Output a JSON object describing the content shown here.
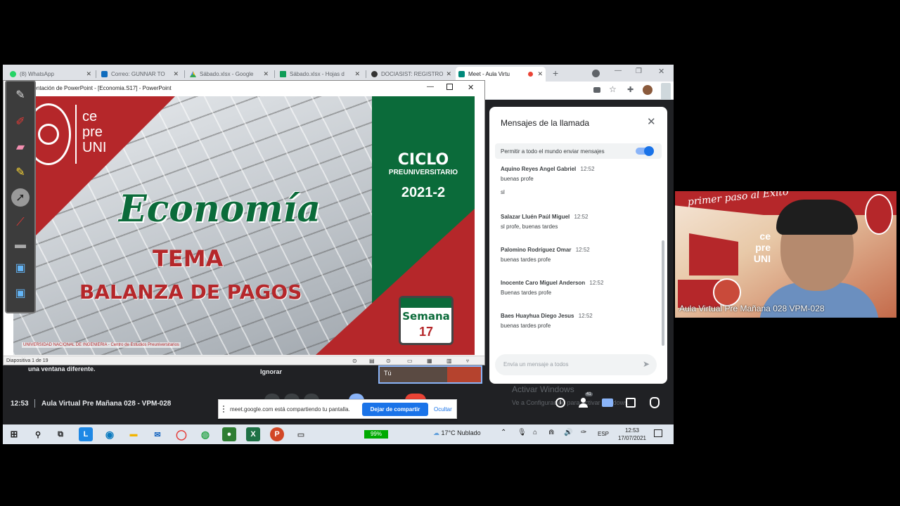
{
  "browser": {
    "tabs": [
      {
        "label": "(8) WhatsApp",
        "color": "#25d366"
      },
      {
        "label": "Correo: GUNNAR TO",
        "color": "#0f6cbd"
      },
      {
        "label": "Sábado.xlsx - Google",
        "color": "#188038"
      },
      {
        "label": "Sábado.xlsx - Hojas d",
        "color": "#0f9d58"
      },
      {
        "label": "DOCIASIST: REGISTRO",
        "color": "#333333"
      },
      {
        "label": "Meet - Aula Virtu",
        "color": "#00897b"
      }
    ],
    "new_tab": "+"
  },
  "powerpoint": {
    "title": "Presentación de PowerPoint - [Economia.S17] - PowerPoint",
    "status": "Diapositiva 1 de 19"
  },
  "slide": {
    "logo_text": [
      "ce",
      "pre",
      "UNI"
    ],
    "ciclo": "CICLO",
    "preuniversitario": "PREUNIVERSITARIO",
    "year": "2021-2",
    "subject": "Economía",
    "tema": "TEMA",
    "topic": "BALANZA DE PAGOS",
    "semana_label": "Semana",
    "semana_num": "17",
    "footer": "UNIVERSIDAD NACIONAL DE INGENIERIA - Centro de Estudios Preuniversitarios"
  },
  "chat": {
    "title": "Mensajes de la llamada",
    "allow_label": "Permitir a todo el mundo enviar mensajes",
    "messages": [
      {
        "name": "Aquino Reyes Angel Gabriel",
        "time": "12:52",
        "texts": [
          "buenas profe",
          "sl"
        ]
      },
      {
        "name": "Salazar Lluén Paúl Miguel",
        "time": "12:52",
        "texts": [
          "sl profe, buenas tardes"
        ]
      },
      {
        "name": "Palomino Rodríguez Omar",
        "time": "12:52",
        "texts": [
          "buenas tardes profe"
        ]
      },
      {
        "name": "Inocente Caro Miguel Anderson",
        "time": "12:52",
        "texts": [
          "Buenas tardes profe"
        ]
      },
      {
        "name": "Baes Huayhua Diego Jesus",
        "time": "12:52",
        "texts": [
          "buenas tardes profe"
        ]
      }
    ],
    "input_placeholder": "Envía un mensaje a todos"
  },
  "meet": {
    "time": "12:53",
    "meeting_name": "Aula Virtual Pre Mañana 028 - VPM-028",
    "notice_text": "una ventana diferente.",
    "ignore": "Ignorar",
    "self_label": "Tú",
    "share_text": "meet.google.com está compartiendo tu pantalla.",
    "stop_share": "Dejar de compartir",
    "hide": "Ocultar",
    "people_count": "41",
    "activate_title": "Activar Windows",
    "activate_sub": "Ve a Configuración para activar Windows."
  },
  "camera": {
    "label": "Aula Virtual Pre Mañana 028 VPM-028",
    "banner": "primer paso al Éxito",
    "logo_text": [
      "ce",
      "pre",
      "UNI"
    ]
  },
  "taskbar": {
    "battery": "99%",
    "weather": "17°C  Nublado",
    "lang": "ESP",
    "time": "12:53",
    "date": "17/07/2021"
  }
}
